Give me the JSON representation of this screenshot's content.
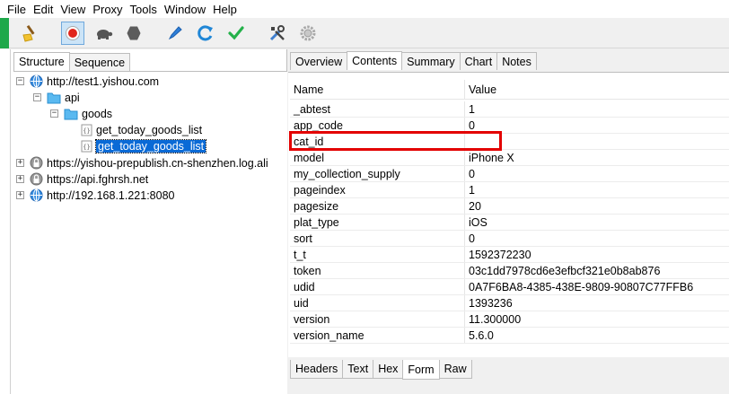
{
  "menu": [
    "File",
    "Edit",
    "View",
    "Proxy",
    "Tools",
    "Window",
    "Help"
  ],
  "toolbar": {
    "icons": [
      "broom-icon",
      "record-icon",
      "turtle-icon",
      "hexagon-stop-icon",
      "pen-icon",
      "refresh-icon",
      "checkmark-icon",
      "tools-icon",
      "gear-icon"
    ]
  },
  "left_tabs": [
    "Structure",
    "Sequence"
  ],
  "tree": {
    "host1": "http://test1.yishou.com",
    "folder_api": "api",
    "folder_goods": "goods",
    "item1": "get_today_goods_list",
    "item2": "get_today_goods_list",
    "host2": "https://yishou-prepublish.cn-shenzhen.log.ali",
    "host3": "https://api.fghrsh.net",
    "host4": "http://192.168.1.221:8080"
  },
  "right_tabs": [
    "Overview",
    "Contents",
    "Summary",
    "Chart",
    "Notes"
  ],
  "table": {
    "col_name": "Name",
    "col_value": "Value",
    "rows": [
      {
        "name": "_abtest",
        "value": "1"
      },
      {
        "name": "app_code",
        "value": "0"
      },
      {
        "name": "cat_id",
        "value": ""
      },
      {
        "name": "model",
        "value": "iPhone X"
      },
      {
        "name": "my_collection_supply",
        "value": "0"
      },
      {
        "name": "pageindex",
        "value": "1"
      },
      {
        "name": "pagesize",
        "value": "20"
      },
      {
        "name": "plat_type",
        "value": "iOS"
      },
      {
        "name": "sort",
        "value": "0"
      },
      {
        "name": "t_t",
        "value": "1592372230"
      },
      {
        "name": "token",
        "value": "03c1dd7978cd6e3efbcf321e0b8ab876"
      },
      {
        "name": "udid",
        "value": "0A7F6BA8-4385-438E-9809-90807C77FFB6"
      },
      {
        "name": "uid",
        "value": "1393236"
      },
      {
        "name": "version",
        "value": "11.300000"
      },
      {
        "name": "version_name",
        "value": "5.6.0"
      }
    ]
  },
  "bottom_tabs": [
    "Headers",
    "Text",
    "Hex",
    "Form",
    "Raw"
  ],
  "colors": {
    "highlight": "#e30000",
    "selection": "#0a6ad6",
    "accent_strip": "#1ea84a"
  }
}
